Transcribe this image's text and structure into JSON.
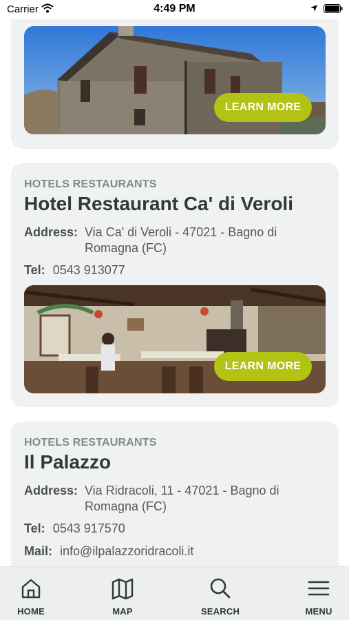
{
  "status_bar": {
    "carrier": "Carrier",
    "time": "4:49 PM"
  },
  "listings": [
    {
      "cta": "LEARN MORE"
    },
    {
      "category": "HOTELS RESTAURANTS",
      "name": "Hotel Restaurant Ca' di Veroli",
      "address_label": "Address:",
      "address": "Via Ca' di Veroli - 47021 - Bagno di Romagna (FC)",
      "tel_label": "Tel:",
      "tel": "0543 913077",
      "cta": "LEARN MORE"
    },
    {
      "category": "HOTELS RESTAURANTS",
      "name": "Il Palazzo",
      "address_label": "Address:",
      "address": "Via Ridracoli, 11 - 47021 - Bagno di Romagna (FC)",
      "tel_label": "Tel:",
      "tel": "0543 917570",
      "mail_label": "Mail:",
      "mail": "info@ilpalazzoridracoli.it"
    }
  ],
  "bottom_nav": [
    {
      "label": "HOME",
      "icon": "home-icon"
    },
    {
      "label": "MAP",
      "icon": "map-icon"
    },
    {
      "label": "SEARCH",
      "icon": "search-icon"
    },
    {
      "label": "MENU",
      "icon": "menu-icon"
    }
  ],
  "colors": {
    "accent": "#b3c313",
    "card_bg": "#f0f1f2",
    "title": "#2f3a36",
    "category": "#7f8a86"
  }
}
